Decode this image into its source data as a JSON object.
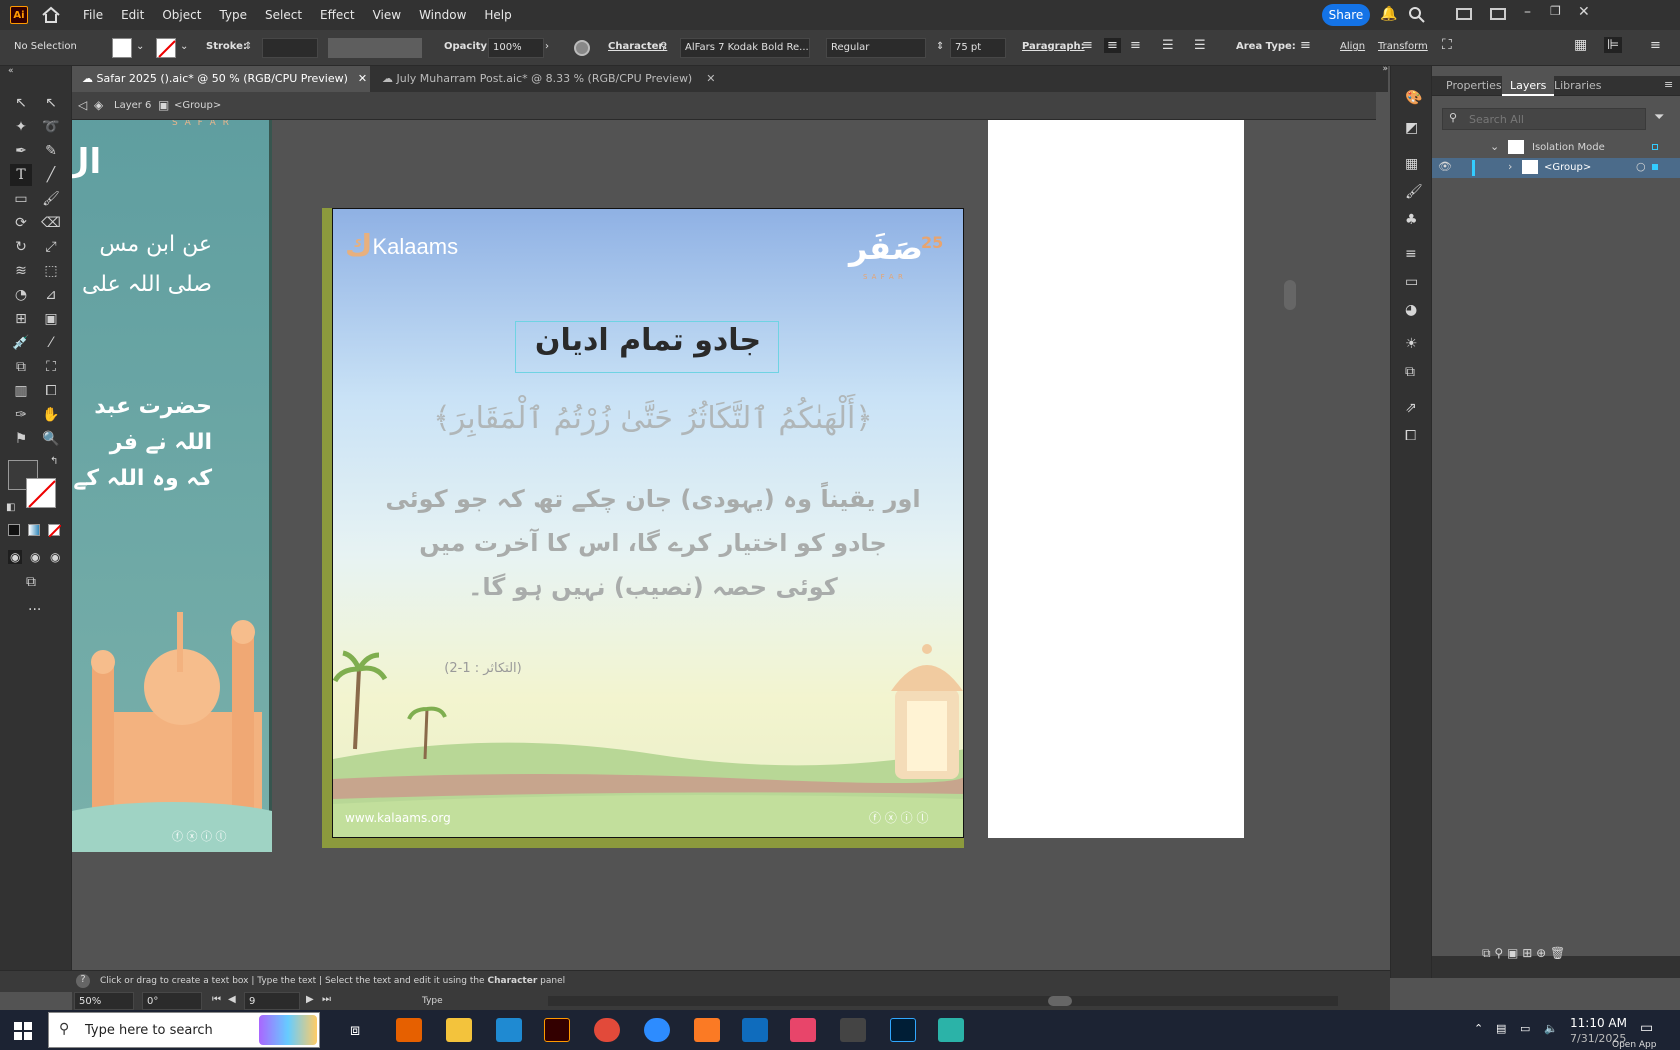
{
  "app": {
    "name": "Ai",
    "menu": [
      "File",
      "Edit",
      "Object",
      "Type",
      "Select",
      "Effect",
      "View",
      "Window",
      "Help"
    ],
    "share_label": "Share"
  },
  "control_bar": {
    "selection": "No Selection",
    "stroke_label": "Stroke:",
    "opacity_label": "Opacity:",
    "opacity_value": "100%",
    "character_label": "Character:",
    "font_family": "AlFars 7 Kodak Bold Re...",
    "font_style": "Regular",
    "font_size": "75 pt",
    "paragraph_label": "Paragraph:",
    "area_type_label": "Area Type:",
    "align_label": "Align",
    "transform_label": "Transform"
  },
  "tabs": [
    {
      "label": "Safar 2025 ().aic* @ 50 % (RGB/CPU Preview)",
      "active": true
    },
    {
      "label": "July Muharram Post.aic* @ 8.33 % (RGB/CPU Preview)",
      "active": false
    }
  ],
  "breadcrumb": {
    "layer": "Layer 6",
    "group": "<Group>"
  },
  "artboard": {
    "brand": "Kalaams",
    "title": "جادو تمام ادیان",
    "ayah": "﴿أَلْهَىٰكُمُ ٱلتَّكَاثُرُ حَتَّىٰ زُرْتُمُ ٱلْمَقَابِرَ﴾",
    "translation_lines": [
      "اور یقیناً وہ (یہودی) جان چکے تھ کہ جو کوئی",
      "جادو کو اختیار کرے گا، اس کا آخرت میں",
      "کوئی حصہ (نصیب) نہیں ہو گا۔"
    ],
    "reference": "(التکاثر : 1-2)",
    "website": "www.kalaams.org",
    "badge_number": "25",
    "badge_word": "S A F A R"
  },
  "left_artboard": {
    "lines": [
      "عن ابن مس",
      "صلی اللہ علی",
      "حضرت عبد",
      "اللہ نے فر",
      "کہ وہ اللہ کے"
    ],
    "top_word": "S A F A R"
  },
  "panel": {
    "tabs": [
      "Properties",
      "Layers",
      "Libraries"
    ],
    "active_tab": "Layers",
    "search_placeholder": "Search All",
    "rows": [
      {
        "label": "Isolation Mode"
      },
      {
        "label": "<Group>"
      }
    ]
  },
  "status": {
    "hint_parts": [
      "Click or drag to create a text box",
      "Type the text",
      "Select the text and edit it using the"
    ],
    "hint_bold": "Character",
    "hint_tail": "panel",
    "zoom": "50%",
    "rotation": "0°",
    "artboard_num": "9",
    "tool": "Type"
  },
  "taskbar": {
    "search_placeholder": "Type here to search",
    "time": "11:10 AM",
    "date": "7/31/2025",
    "open_app": "Open App"
  }
}
